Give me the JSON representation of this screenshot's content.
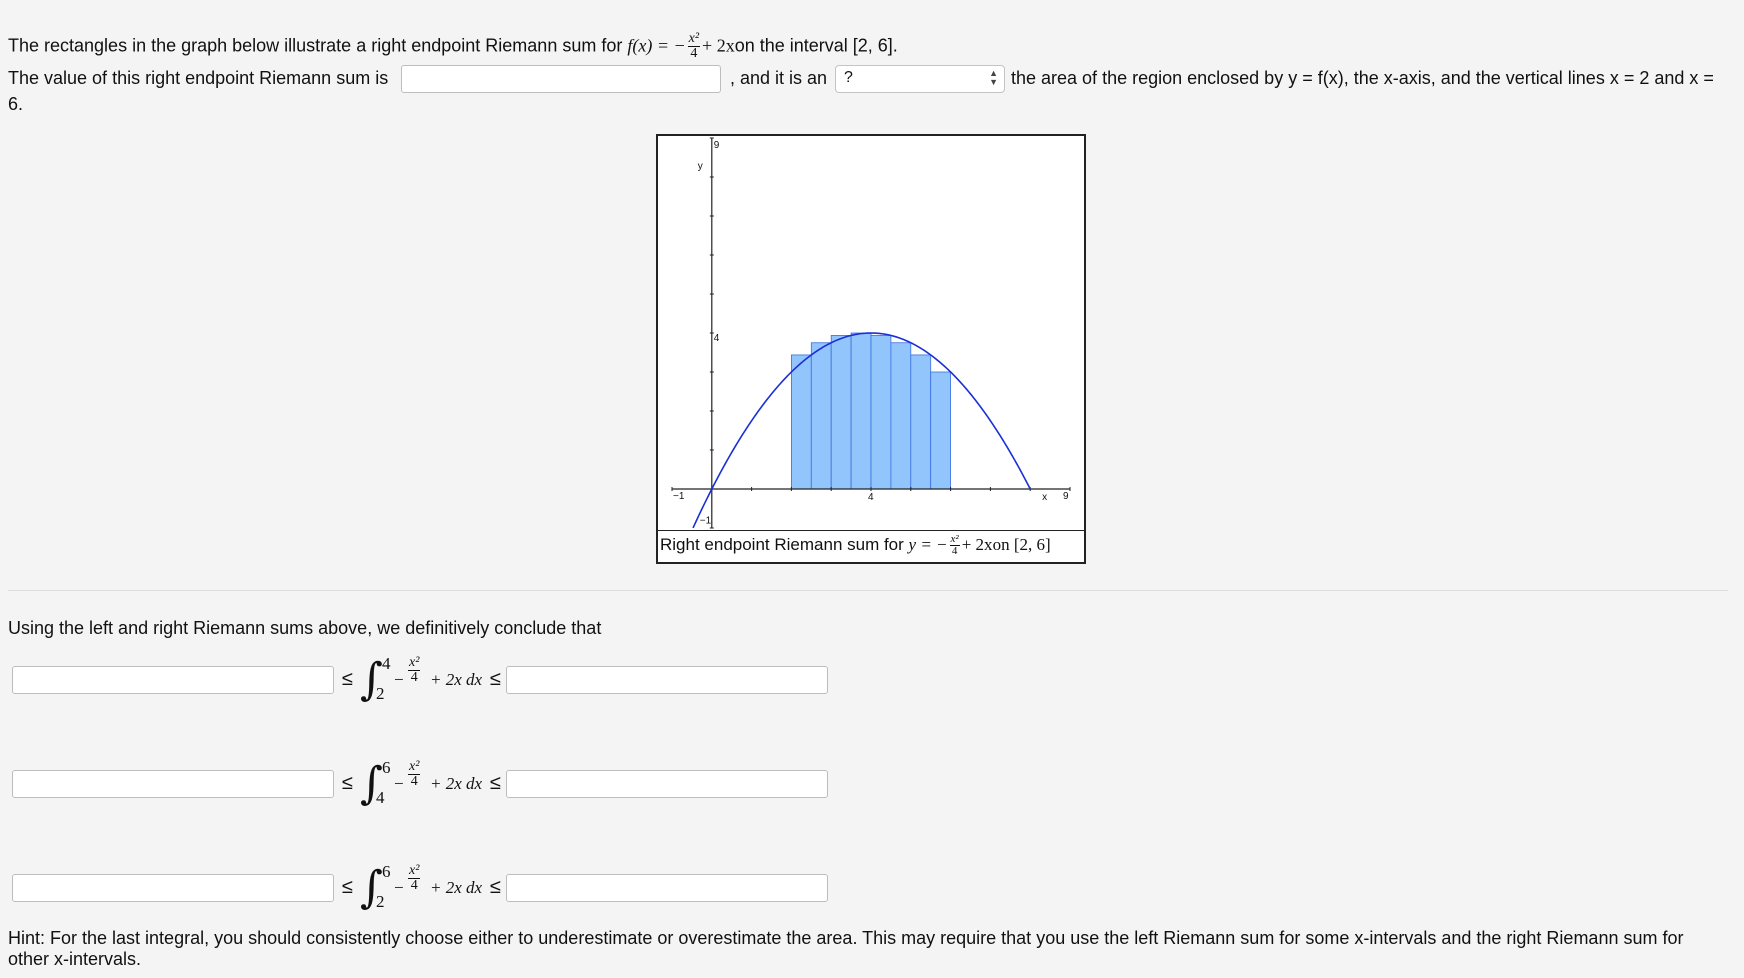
{
  "intro": {
    "line1_prefix": "The rectangles in the graph below illustrate a right endpoint Riemann sum for ",
    "func_label": "f(x) = −",
    "frac_num": "x²",
    "frac_den": "4",
    "func_tail": "+ 2x",
    "line1_suffix": "on the interval [2, 6]."
  },
  "question": {
    "value_prefix": "The value of this right endpoint Riemann sum is",
    "value_input": "",
    "mid_text": ", and it is an",
    "select_value": "?",
    "suffix": "the area of the region enclosed by y = f(x), the x-axis, and the vertical lines x = 2 and x =",
    "wrap": "6."
  },
  "graph": {
    "y_axis_label": "y",
    "x_axis_label": "x",
    "y_top_tick": "9",
    "y_mid_tick": "4",
    "y_bottom_tick": "−1",
    "x_left_tick": "−1",
    "x_mid_tick": "4",
    "x_right_tick": "9",
    "caption_prefix": "Right endpoint Riemann sum for ",
    "caption_math": "y = −",
    "caption_frac_num": "x²",
    "caption_frac_den": "4",
    "caption_tail": "+ 2x",
    "caption_suffix": "on [2, 6]",
    "curve_color": "#1a2fd6",
    "bar_color": "#93c5fd",
    "bar_edge": "#3b6fe0",
    "rectangles": [
      {
        "x_left": 2.0,
        "x_right": 2.5,
        "height": 3.4375
      },
      {
        "x_left": 2.5,
        "x_right": 3.0,
        "height": 3.75
      },
      {
        "x_left": 3.0,
        "x_right": 3.5,
        "height": 3.9375
      },
      {
        "x_left": 3.5,
        "x_right": 4.0,
        "height": 4.0
      },
      {
        "x_left": 4.0,
        "x_right": 4.5,
        "height": 3.9375
      },
      {
        "x_left": 4.5,
        "x_right": 5.0,
        "height": 3.75
      },
      {
        "x_left": 5.0,
        "x_right": 5.5,
        "height": 3.4375
      },
      {
        "x_left": 5.5,
        "x_right": 6.0,
        "height": 3.0
      }
    ],
    "x_range": [
      -1,
      9
    ],
    "y_range": [
      -1,
      9
    ]
  },
  "conclusion": {
    "intro": "Using the left and right Riemann sums above, we definitively conclude that",
    "rows": [
      {
        "lower_value": "",
        "upper_value": "",
        "a": "2",
        "b": "4"
      },
      {
        "lower_value": "",
        "upper_value": "",
        "a": "4",
        "b": "6"
      },
      {
        "lower_value": "",
        "upper_value": "",
        "a": "2",
        "b": "6"
      }
    ],
    "integrand_minus": "−",
    "integrand_num": "x²",
    "integrand_den": "4",
    "integrand_tail": "+ 2x dx",
    "leq": "≤"
  },
  "hint": "Hint: For the last integral, you should consistently choose either to underestimate or overestimate the area. This may require that you use the left Riemann sum for some x-intervals and the right Riemann sum for other x-intervals."
}
